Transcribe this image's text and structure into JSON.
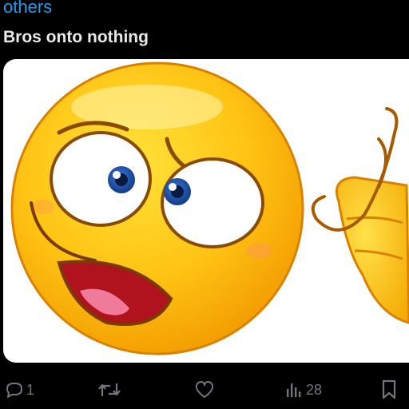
{
  "post": {
    "mention_text": "others",
    "body": "Bros onto nothing",
    "media": {
      "description_icon": "emoji-crazy-face-icon"
    }
  },
  "actions": {
    "reply": {
      "icon": "reply-icon",
      "count": "1"
    },
    "repost": {
      "icon": "repost-icon",
      "count": ""
    },
    "like": {
      "icon": "heart-icon",
      "count": ""
    },
    "views": {
      "icon": "views-chart-icon",
      "count": "28"
    },
    "bookmark": {
      "icon": "bookmark-icon",
      "count": ""
    }
  },
  "colors": {
    "background": "#000000",
    "link": "#1d9bf0",
    "text": "#e7e9ea",
    "icon": "#71767b"
  }
}
